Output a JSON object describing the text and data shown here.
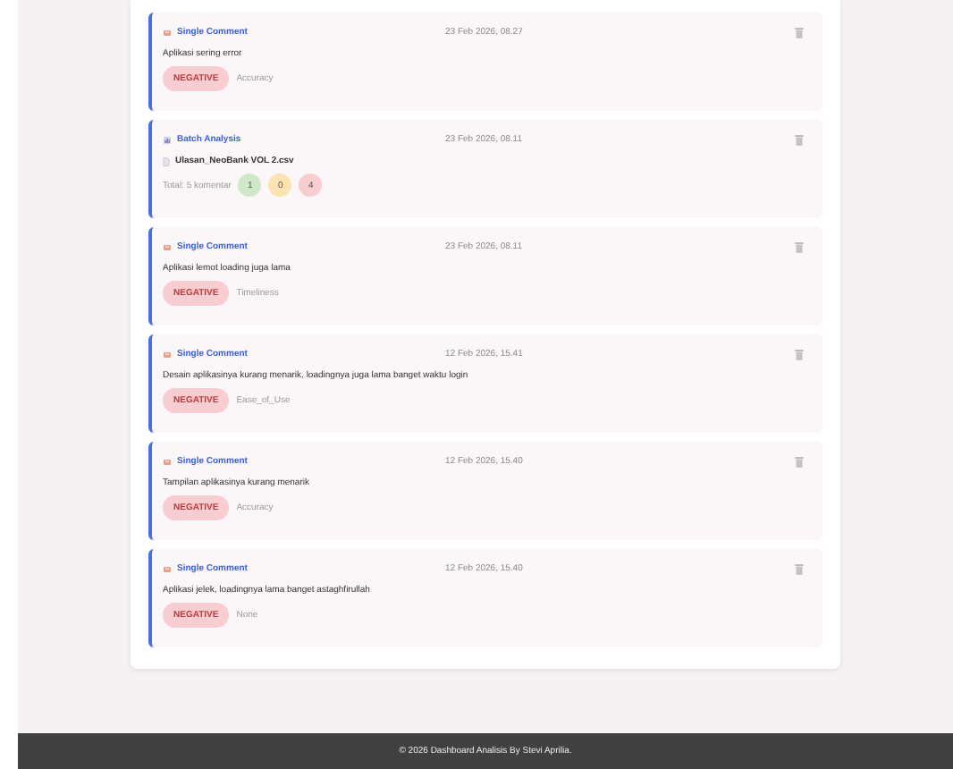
{
  "history": [
    {
      "kind": "single",
      "type": "Single Comment",
      "date": "23 Feb 2026, 08.27",
      "text": "Aplikasi sering error",
      "sentiment": "NEGATIVE",
      "aspect": "Accuracy"
    },
    {
      "kind": "batch",
      "type": "Batch Analysis",
      "date": "23 Feb 2026, 08.11",
      "file": "Ulasan_NeoBank VOL 2.csv",
      "total": "Total: 5 komentar",
      "counts": [
        {
          "value": "1",
          "color": "#cfe8c8"
        },
        {
          "value": "0",
          "color": "#fde3b0"
        },
        {
          "value": "4",
          "color": "#f8cdd0"
        }
      ]
    },
    {
      "kind": "single",
      "type": "Single Comment",
      "date": "23 Feb 2026, 08.11",
      "text": "Aplikasi lemot loading juga lama",
      "sentiment": "NEGATIVE",
      "aspect": "Timeliness"
    },
    {
      "kind": "single",
      "type": "Single Comment",
      "date": "12 Feb 2026, 15.41",
      "text": "Desain aplikasinya kurang menarik, loadingnya juga lama banget waktu login",
      "sentiment": "NEGATIVE",
      "aspect": "Ease_of_Use"
    },
    {
      "kind": "single",
      "type": "Single Comment",
      "date": "12 Feb 2026, 15.40",
      "text": "Tampilan aplikasinya kurang menarik",
      "sentiment": "NEGATIVE",
      "aspect": "Accuracy"
    },
    {
      "kind": "single",
      "type": "Single Comment",
      "date": "12 Feb 2026, 15.40",
      "text": "Aplikasi jelek, loadingnya lama banget astaghfirullah",
      "sentiment": "NEGATIVE",
      "aspect": "None"
    }
  ],
  "footer": "© 2026 Dashboard Analisis By Stevi Aprilia."
}
